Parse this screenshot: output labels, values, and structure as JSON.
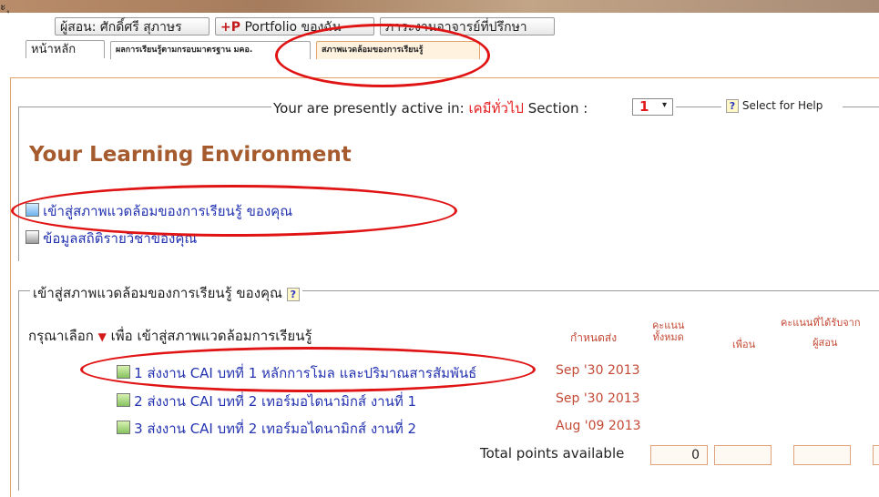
{
  "header": {
    "crumb": "ะ ุ",
    "instructor_label": "ผู้สอน: ศักดิ์ศรี สุภาษร",
    "portfolio_plus": "+P",
    "portfolio_label": " Portfolio ของฉัน",
    "advisor_label": "ภาระงานอาจารย์ที่ปรึกษา"
  },
  "tabs": [
    {
      "label": "หน้าหลัก"
    },
    {
      "label": "ผลการเรียนรู้ตามกรอบมาตรฐาน มคอ."
    },
    {
      "label": "สภาพแวดล้อมของการเรียนรู้"
    }
  ],
  "active_bar": {
    "prefix": "Your are presently active in: ",
    "course": "เคมีทั่วไป",
    "section_label": " Section : ",
    "section_value": "1",
    "dropdown_arrow": "▾",
    "help_icon": "?",
    "help_text": "Select for Help"
  },
  "main": {
    "title": "Your Learning Environment",
    "links": [
      {
        "label": "เข้าสู่สภาพแวดล้อมของการเรียนรู้ ของคุณ",
        "icon": "blue-square-icon"
      },
      {
        "label": "ข้อมูลสถิติรายวิชาของคุณ",
        "icon": "gray-square-icon"
      }
    ]
  },
  "assignments_section": {
    "legend": "เข้าสู่สภาพแวดล้อมของการเรียนรู้ ของคุณ",
    "help_icon": "?",
    "hint_prefix": "กรุณาเลือก ",
    "hint_arrow": "▼",
    "hint_suffix": " เพื่อ เข้าสู่สภาพแวดล้อมการเรียนรู้",
    "columns": {
      "due": "กำหนดส่ง",
      "total_score_line1": "คะแนน",
      "total_score_line2": "ทั้งหมด",
      "friend": "เพื่อน",
      "received_line1": "คะแนนที่ได้รับจาก",
      "received_line2": "ผู้สอน"
    },
    "rows": [
      {
        "label": "1 ส่งงาน CAI บทที่ 1 หลักการโมล และปริมาณสารสัมพันธ์",
        "due": "Sep '30 2013"
      },
      {
        "label": "2 ส่งงาน CAI บทที่ 2 เทอร์มอไดนามิกส์ งานที่ 1",
        "due": "Sep '30 2013"
      },
      {
        "label": "3 ส่งงาน CAI บทที่ 2 เทอร์มอไดนามิกส์ งานที่ 2",
        "due": "Aug '09 2013"
      }
    ],
    "total_label": "Total points available",
    "total_value": "0"
  },
  "colors": {
    "accent_border": "#e2a36b",
    "title_brown": "#a65b2e",
    "link_blue": "#2433b0",
    "red_text": "#e41c1c",
    "annotation_red": "#e01414"
  }
}
